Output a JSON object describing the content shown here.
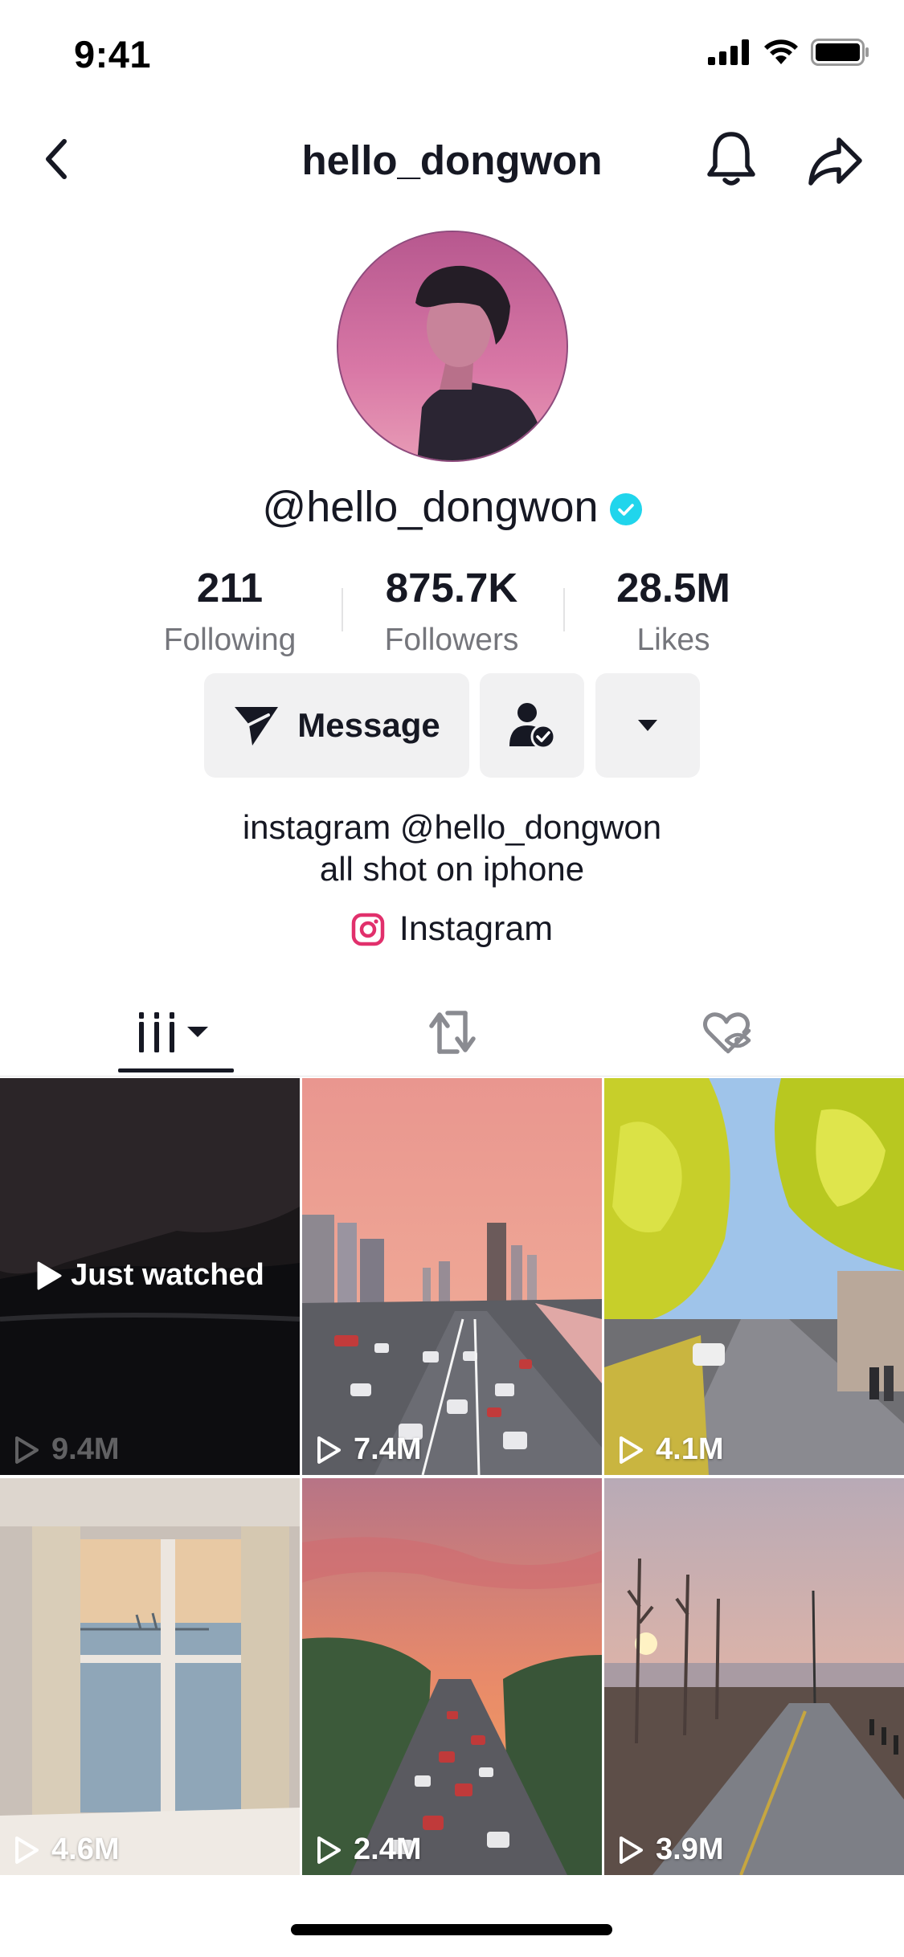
{
  "status_bar": {
    "time": "9:41"
  },
  "header": {
    "title": "hello_dongwon"
  },
  "profile": {
    "username": "@hello_dongwon",
    "verified": true,
    "stats": [
      {
        "value": "211",
        "label": "Following"
      },
      {
        "value": "875.7K",
        "label": "Followers"
      },
      {
        "value": "28.5M",
        "label": "Likes"
      }
    ]
  },
  "actions": {
    "message_label": "Message"
  },
  "bio": {
    "line1": "instagram @hello_dongwon",
    "line2": "all shot on iphone",
    "link_label": "Instagram"
  },
  "tabs": [
    {
      "icon": "videos-grid-icon",
      "active": true
    },
    {
      "icon": "repost-icon",
      "active": false
    },
    {
      "icon": "liked-hidden-icon",
      "active": false
    }
  ],
  "videos": [
    {
      "views": "9.4M",
      "overlay": "Just watched",
      "dimmed": true
    },
    {
      "views": "7.4M"
    },
    {
      "views": "4.1M"
    },
    {
      "views": "4.6M"
    },
    {
      "views": "2.4M"
    },
    {
      "views": "3.9M"
    }
  ],
  "colors": {
    "text": "#161823",
    "secondary_text": "#75767c",
    "button_bg": "#f1f1f2",
    "verified": "#20d5ec",
    "instagram": "#e1306c"
  }
}
